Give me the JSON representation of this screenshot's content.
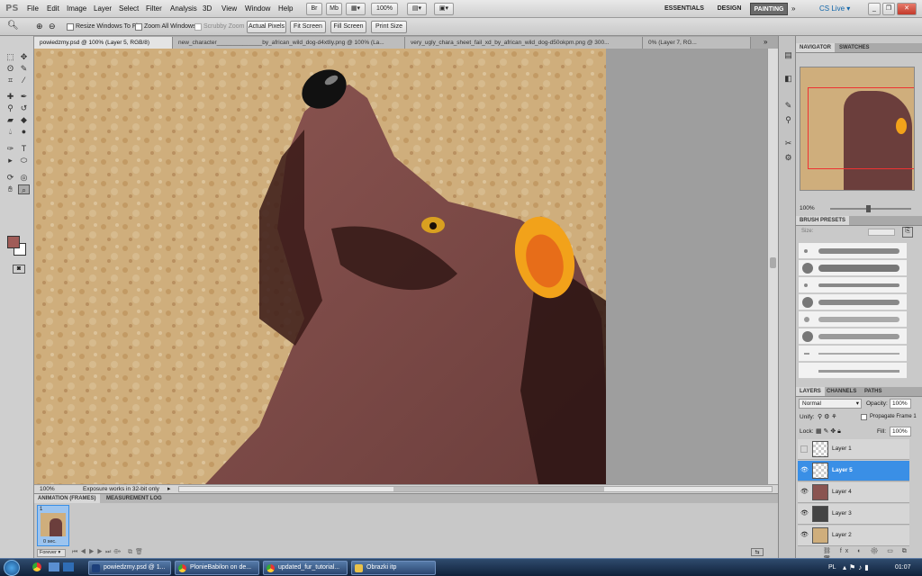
{
  "app": {
    "logo": "PS"
  },
  "menu": [
    "File",
    "Edit",
    "Image",
    "Layer",
    "Select",
    "Filter",
    "Analysis",
    "3D",
    "View",
    "Window",
    "Help"
  ],
  "menubar": {
    "zoom": "100%",
    "workspaces": [
      "ESSENTIALS",
      "DESIGN",
      "PAINTING"
    ],
    "active_workspace": "PAINTING",
    "cslive": "CS Live"
  },
  "options": {
    "resize_windows": "Resize Windows To Fit",
    "zoom_all": "Zoom All Windows",
    "scrubby": "Scrubby Zoom",
    "buttons": [
      "Actual Pixels",
      "Fit Screen",
      "Fill Screen",
      "Print Size"
    ]
  },
  "tabs": [
    "powiedzmy.psd @ 100% (Layer 5, RGB/8)",
    "new_character______________by_african_wild_dog-d4xtlly.png @ 100% (La...",
    "very_ugly_chara_sheet_fail_xd_by_african_wild_dog-d50okpm.png @ 300...",
    "0% (Layer 7, RG..."
  ],
  "status": {
    "zoom": "100%",
    "message": "Exposure works in 32-bit only"
  },
  "animation": {
    "tabs": [
      "ANIMATION (FRAMES)",
      "MEASUREMENT LOG"
    ],
    "frame_number": "1",
    "frame_time": "0 sec.",
    "loop": "Forever"
  },
  "navigator": {
    "tabs": [
      "NAVIGATOR",
      "SWATCHES"
    ],
    "zoom": "100%"
  },
  "brush_presets": {
    "title": "BRUSH PRESETS",
    "size_label": "Size:"
  },
  "layers_panel": {
    "tabs": [
      "LAYERS",
      "CHANNELS",
      "PATHS"
    ],
    "blend_mode": "Normal",
    "opacity_label": "Opacity:",
    "opacity": "100%",
    "unify_label": "Unify:",
    "propagate": "Propagate Frame 1",
    "lock_label": "Lock:",
    "fill_label": "Fill:",
    "fill": "100%",
    "layers": [
      {
        "name": "Layer 1",
        "visible": false,
        "selected": false
      },
      {
        "name": "Layer 5",
        "visible": true,
        "selected": true
      },
      {
        "name": "Layer 4",
        "visible": true,
        "selected": false
      },
      {
        "name": "Layer 3",
        "visible": true,
        "selected": false
      },
      {
        "name": "Layer 2",
        "visible": true,
        "selected": false
      }
    ]
  },
  "taskbar": {
    "tasks": [
      "powiedzmy.psd @ 1...",
      "PlonieBabilon on de...",
      "updated_fur_tutorial...",
      "Obrazki itp"
    ],
    "lang": "PL",
    "time": "01:07"
  },
  "colors": {
    "foreground": "#a05c58",
    "background": "#ffffff",
    "accent": "#3a8fe6"
  }
}
